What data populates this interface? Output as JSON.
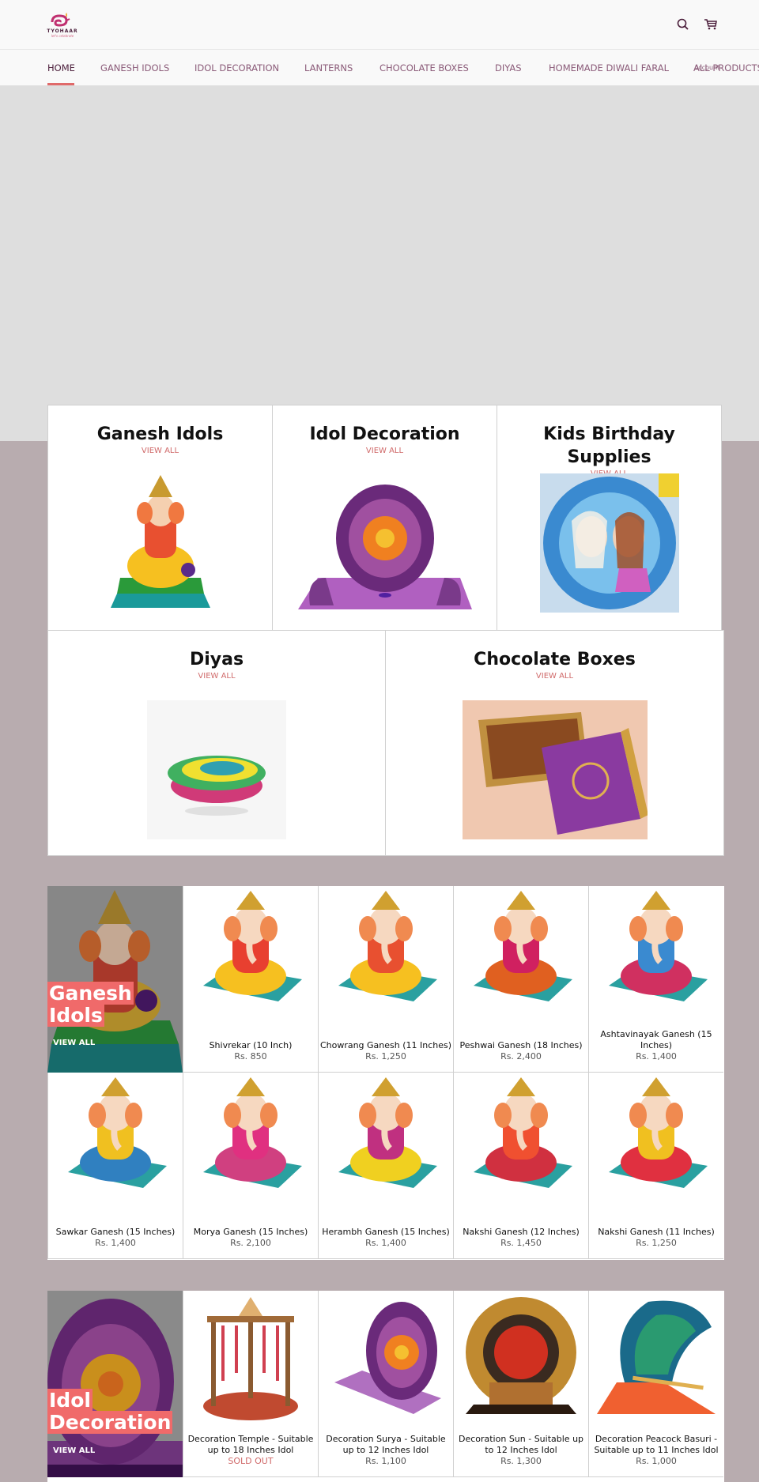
{
  "header": {
    "logo_text": "TYOHAAR",
    "logo_tagline": "let's celebrate",
    "search_icon": "search-icon",
    "cart_icon": "cart-icon"
  },
  "nav": {
    "items": [
      {
        "label": "HOME",
        "active": true
      },
      {
        "label": "GANESH IDOLS"
      },
      {
        "label": "IDOL DECORATION"
      },
      {
        "label": "LANTERNS"
      },
      {
        "label": "CHOCOLATE BOXES"
      },
      {
        "label": "DIYAS"
      },
      {
        "label": "HOMEMADE DIWALI FARAL"
      },
      {
        "label": "ALL PRODUCTS"
      }
    ],
    "account_label": "Account"
  },
  "collections": [
    {
      "title": "Ganesh Idols",
      "link": "VIEW ALL"
    },
    {
      "title": "Idol Decoration",
      "link": "VIEW ALL"
    },
    {
      "title": "Kids Birthday Supplies",
      "link": "VIEW ALL"
    },
    {
      "title": "Diyas",
      "link": "VIEW ALL"
    },
    {
      "title": "Chocolate Boxes",
      "link": "VIEW ALL"
    }
  ],
  "featured_ganesh": {
    "title_line1": "Ganesh",
    "title_line2": "Idols",
    "link": "VIEW ALL",
    "products": [
      {
        "name": "Shivrekar (10 Inch)",
        "price": "Rs. 850"
      },
      {
        "name": "Chowrang Ganesh (11 Inches)",
        "price": "Rs. 1,250"
      },
      {
        "name": "Peshwai Ganesh (18 Inches)",
        "price": "Rs. 2,400"
      },
      {
        "name": "Ashtavinayak Ganesh (15 Inches)",
        "price": "Rs. 1,400"
      },
      {
        "name": "Sawkar Ganesh (15 Inches)",
        "price": "Rs. 1,400"
      },
      {
        "name": "Morya Ganesh (15 Inches)",
        "price": "Rs. 2,100"
      },
      {
        "name": "Herambh Ganesh (15 Inches)",
        "price": "Rs. 1,400"
      },
      {
        "name": "Nakshi Ganesh (12 Inches)",
        "price": "Rs. 1,450"
      },
      {
        "name": "Nakshi Ganesh (11 Inches)",
        "price": "Rs. 1,250"
      }
    ]
  },
  "featured_decoration": {
    "title_line1": "Idol",
    "title_line2": "Decoration",
    "link": "VIEW ALL",
    "products": [
      {
        "name": "Decoration Temple - Suitable up to 18 Inches Idol",
        "price": "SOLD OUT",
        "sold_out": true
      },
      {
        "name": "Decoration Surya - Suitable up to 12 Inches Idol",
        "price": "Rs. 1,100"
      },
      {
        "name": "Decoration Sun - Suitable up to 12 Inches Idol",
        "price": "Rs. 1,300"
      },
      {
        "name": "Decoration Peacock Basuri - Suitable up to 11 Inches Idol",
        "price": "Rs. 1,000"
      }
    ]
  },
  "colors": {
    "accent": "#f06a6a",
    "link": "#d06a6a",
    "nav_text": "#8a5a78",
    "nav_active": "#4a1d3a",
    "page_bg": "#b8acaf",
    "hero_bg": "#dedede"
  }
}
